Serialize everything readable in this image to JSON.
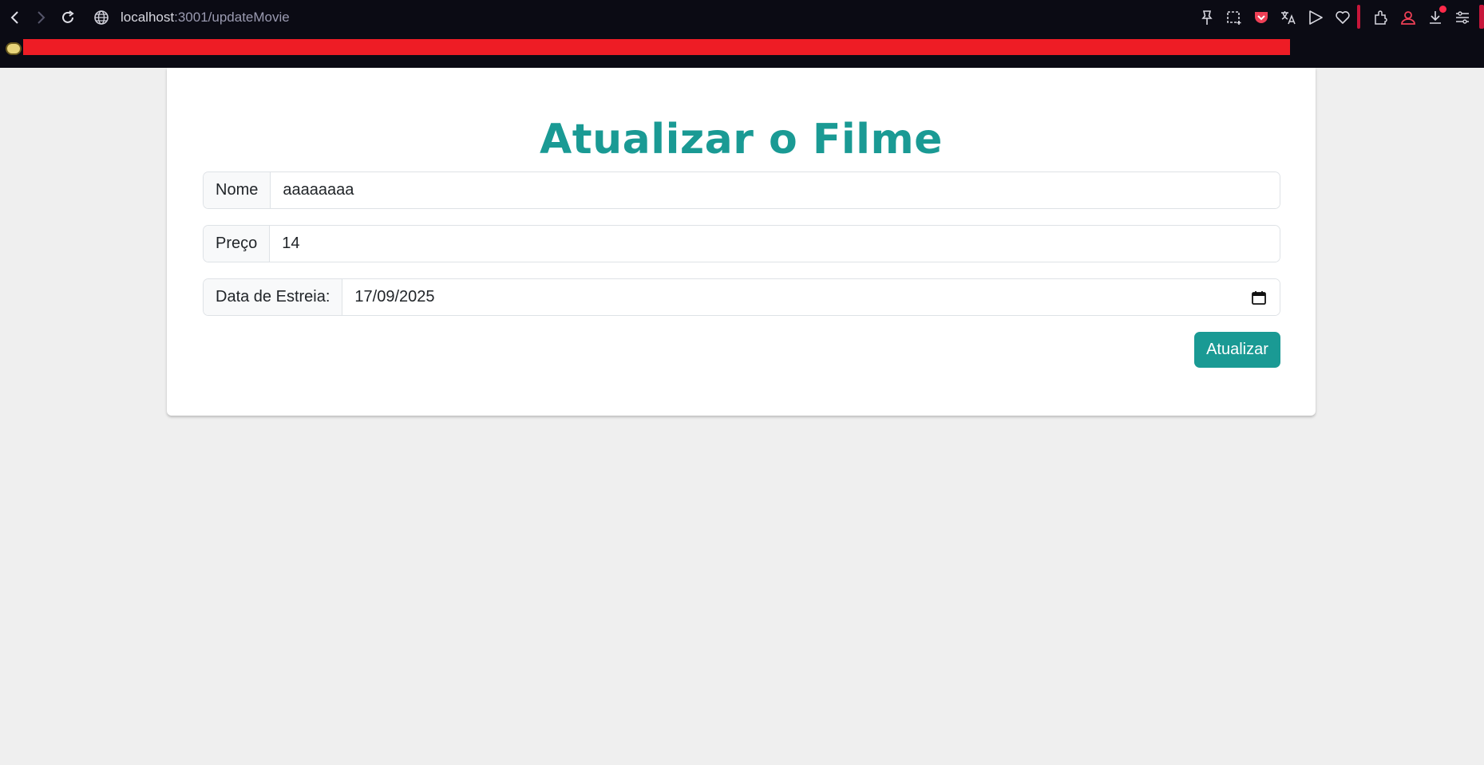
{
  "browser": {
    "url_host": "localhost",
    "url_path": ":3001/updateMovie",
    "icons": [
      "back-icon",
      "forward-icon",
      "reload-icon",
      "globe-icon",
      "pin-icon",
      "screenshot-icon",
      "pocket-icon",
      "translate-icon",
      "send-icon",
      "heart-icon",
      "extensions-icon",
      "profile-icon",
      "download-icon",
      "menu-icon"
    ]
  },
  "form": {
    "title": "Atualizar o Filme",
    "name_label": "Nome",
    "name_value": "aaaaaaaa",
    "price_label": "Preço",
    "price_value": "14",
    "date_label": "Data de Estreia:",
    "date_value": "17/09/2025",
    "submit_label": "Atualizar"
  },
  "colors": {
    "accent": "#1a9a94",
    "page_bg": "#efefef",
    "chrome_bg": "#0b0b14"
  }
}
